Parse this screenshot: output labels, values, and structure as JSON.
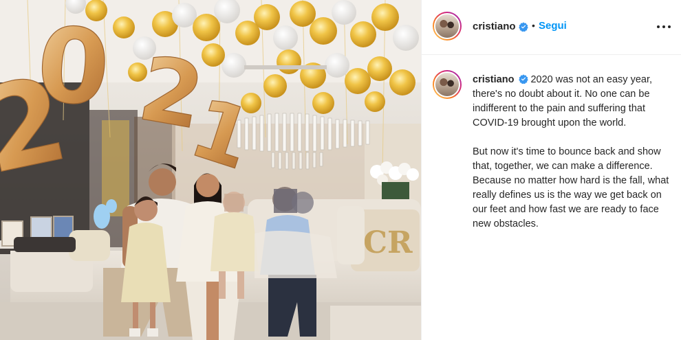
{
  "post": {
    "username": "cristiano",
    "follow_label": "Segui",
    "separator": "•",
    "verified": true,
    "menu_icon": "more-options-icon"
  },
  "caption": {
    "username": "cristiano",
    "paragraph_1": "2020 was not an easy year, there's no doubt about it. No one can be indifferent to the pain and suffering that COVID-19 brought upon the world.",
    "paragraph_2": "But now it's time to bounce back and show that, together, we can make a difference. Because no matter how hard is the fall, what really defines us is the way we get back on our feet and how fast we are ready to face new obstacles."
  },
  "photo": {
    "balloon_digits": [
      "2",
      "0",
      "2",
      "1"
    ],
    "pillow_monogram": "CR"
  },
  "colors": {
    "accent_blue": "#0095f6",
    "gold": "#e2b64a",
    "text": "#262626",
    "border": "#efefef"
  }
}
